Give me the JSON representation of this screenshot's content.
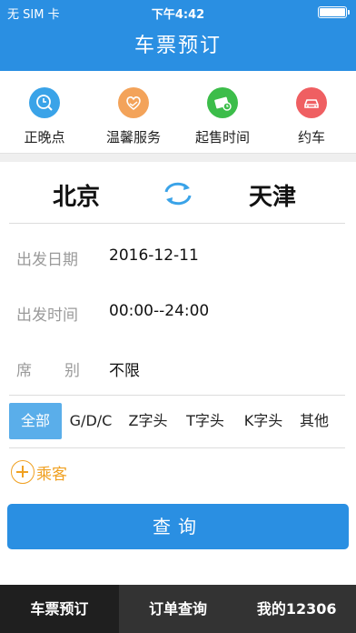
{
  "status_bar": {
    "carrier": "无 SIM 卡",
    "time": "下午4:42"
  },
  "nav": {
    "title": "车票预订"
  },
  "quick_links": [
    {
      "label": "正晚点",
      "icon": "clock-search-icon",
      "color": "#3aa3e8"
    },
    {
      "label": "温馨服务",
      "icon": "handshake-heart-icon",
      "color": "#f3a35a"
    },
    {
      "label": "起售时间",
      "icon": "ticket-clock-icon",
      "color": "#3cbd4a"
    },
    {
      "label": "约车",
      "icon": "car-icon",
      "color": "#ef5f62"
    }
  ],
  "route": {
    "from": "北京",
    "to": "天津",
    "swap_icon": "swap-arrows-icon"
  },
  "form": {
    "date_label": "出发日期",
    "date_value": "2016-12-11",
    "time_label": "出发时间",
    "time_value": "00:00--24:00",
    "seat_label_1": "席",
    "seat_label_2": "别",
    "seat_value": "不限"
  },
  "train_types": [
    "全部",
    "G/D/C",
    "Z字头",
    "T字头",
    "K字头",
    "其他"
  ],
  "train_type_selected": "全部",
  "passenger": {
    "label": "乘客"
  },
  "query_button": "查询",
  "tabbar": [
    "车票预订",
    "订单查询",
    "我的12306"
  ],
  "tabbar_active": "车票预订",
  "colors": {
    "primary": "#2a8fe2",
    "accent": "#f0a020",
    "tabbar": "#333333"
  }
}
